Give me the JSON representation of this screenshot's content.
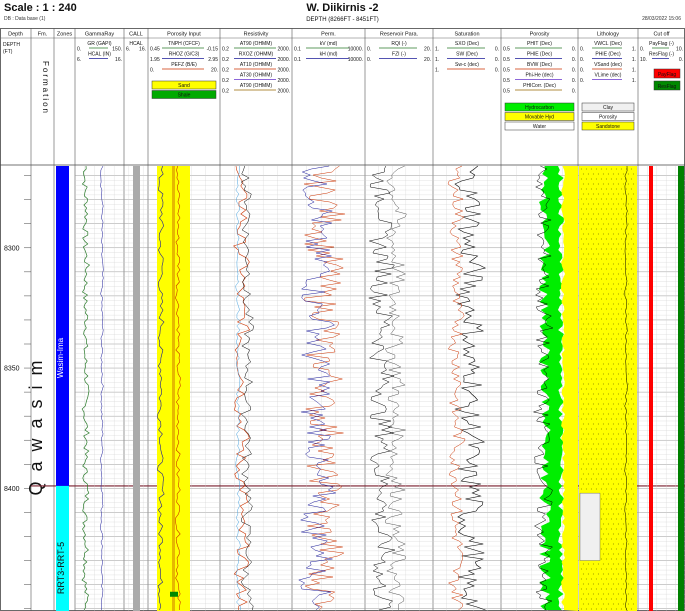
{
  "header": {
    "scale": "Scale : 1 : 240",
    "db": "DB : Data base (1)",
    "well": "W. Diikirnis -2",
    "depth_range": "DEPTH (8266FT - 8451FT)",
    "date": "28/03/2022 15:06"
  },
  "tracks": [
    {
      "key": "depth",
      "title": "Depth",
      "lines": [
        {
          "name": "DEPTH",
          "sub": "(FT)"
        }
      ]
    },
    {
      "key": "fm",
      "title": "Fm.",
      "lines": []
    },
    {
      "key": "zones",
      "title": "Zones",
      "lines": []
    },
    {
      "key": "gr",
      "title": "GammaRay",
      "lines": [
        {
          "name": "GR (GAPI)",
          "left": "0.",
          "right": "150."
        },
        {
          "name": "HCAL (IN)",
          "left": "6.",
          "right": "16."
        }
      ]
    },
    {
      "key": "call",
      "title": "CALL",
      "lines": [
        {
          "name": "HCAL",
          "left": "6.",
          "right": "16."
        }
      ]
    },
    {
      "key": "por",
      "title": "Porosity Input",
      "lines": [
        {
          "name": "TNPH (CFCF)",
          "left": "0.45",
          "right": "-0.15"
        },
        {
          "name": "RHOZ (G/C3)",
          "left": "1.95",
          "right": "2.95"
        },
        {
          "name": "PEFZ (B/E)",
          "left": "0.",
          "right": "20."
        }
      ]
    },
    {
      "key": "res",
      "title": "Resistivity",
      "lines": [
        {
          "name": "AT90 (OHMM)",
          "left": "0.2",
          "right": "2000."
        },
        {
          "name": "RXOZ (OHMM)",
          "left": "0.2",
          "right": "2000."
        },
        {
          "name": "AT10 (OHMM)",
          "left": "0.2",
          "right": "2000."
        },
        {
          "name": "AT30 (OHMM)",
          "left": "0.2",
          "right": "2000."
        },
        {
          "name": "AT90 (OHMM)",
          "left": "0.2",
          "right": "2000."
        }
      ]
    },
    {
      "key": "perm",
      "title": "Perm.",
      "lines": [
        {
          "name": "kV (md)",
          "left": "0.1",
          "right": "10000."
        },
        {
          "name": "kH (md)",
          "left": "0.1",
          "right": "10000."
        }
      ]
    },
    {
      "key": "rp",
      "title": "Reservoir Para.",
      "lines": [
        {
          "name": "RQI (-)",
          "left": "0.",
          "right": "20."
        },
        {
          "name": "FZI (-)",
          "left": "0.",
          "right": "20."
        }
      ]
    },
    {
      "key": "sat",
      "title": "Saturation",
      "lines": [
        {
          "name": "SXO (Dec)",
          "left": "1.",
          "right": "0."
        },
        {
          "name": "SW (Dec)",
          "left": "1.",
          "right": "0."
        },
        {
          "name": "Sw-c (dec)",
          "left": "1.",
          "right": "0."
        }
      ]
    },
    {
      "key": "phi",
      "title": "Porosity",
      "lines": [
        {
          "name": "PHIT (Dec)",
          "left": "0.5",
          "right": "0."
        },
        {
          "name": "PHIE (Dec)",
          "left": "0.5",
          "right": "0."
        },
        {
          "name": "BVW (Dec)",
          "left": "0.5",
          "right": "0."
        },
        {
          "name": "Phi-He (dec)",
          "left": "0.5",
          "right": "0."
        },
        {
          "name": "PHICorr. (Dec)",
          "left": "0.5",
          "right": "0."
        }
      ]
    },
    {
      "key": "lith",
      "title": "Lithology",
      "lines": [
        {
          "name": "VWCL (Dec)",
          "left": "0.",
          "right": "1."
        },
        {
          "name": "PHIE (Dec)",
          "left": "0.",
          "right": "1."
        },
        {
          "name": "VSand (dec)",
          "left": "0.",
          "right": "1."
        },
        {
          "name": "VLime (dec)",
          "left": "0.",
          "right": "1."
        }
      ]
    },
    {
      "key": "cut",
      "title": "Cut off",
      "lines": [
        {
          "name": "PayFlag (-)",
          "left": "0.",
          "right": "10."
        },
        {
          "name": "ResFlag (-)",
          "left": "10.",
          "right": "0."
        }
      ]
    }
  ],
  "legends": {
    "por": [
      {
        "label": "Sand",
        "color": "#ffff00"
      },
      {
        "label": "Shale",
        "color": "#00aa00"
      }
    ],
    "phi": [
      {
        "label": "Hydrocarbon",
        "color": "#00ee00"
      },
      {
        "label": "Movable Hyd",
        "color": "#ffff00"
      },
      {
        "label": "Water",
        "color": "#ffffff"
      }
    ],
    "lith": [
      {
        "label": "Clay",
        "color": "#f0f0f0"
      },
      {
        "label": "Porosity",
        "color": "#ffffff"
      },
      {
        "label": "Sandstone",
        "color": "#ffff00"
      }
    ],
    "cut": [
      {
        "label": "PayFlag",
        "color": "#ff0000"
      },
      {
        "label": "ResFlag",
        "color": "#008800"
      }
    ]
  },
  "depth_ticks": [
    8300,
    8350,
    8400
  ],
  "formation": {
    "name": "Formation",
    "value": "Qawasim"
  },
  "zones": [
    {
      "name": "Wasim-Ima"
    },
    {
      "name": "RRT3-RRT-5"
    }
  ],
  "colors": {
    "zone1": "#0000ff",
    "zone2": "#00ffff",
    "sand": "#ffff00",
    "hc": "#00ee00",
    "flagRed": "#ff0000",
    "flagGreen": "#008000"
  }
}
